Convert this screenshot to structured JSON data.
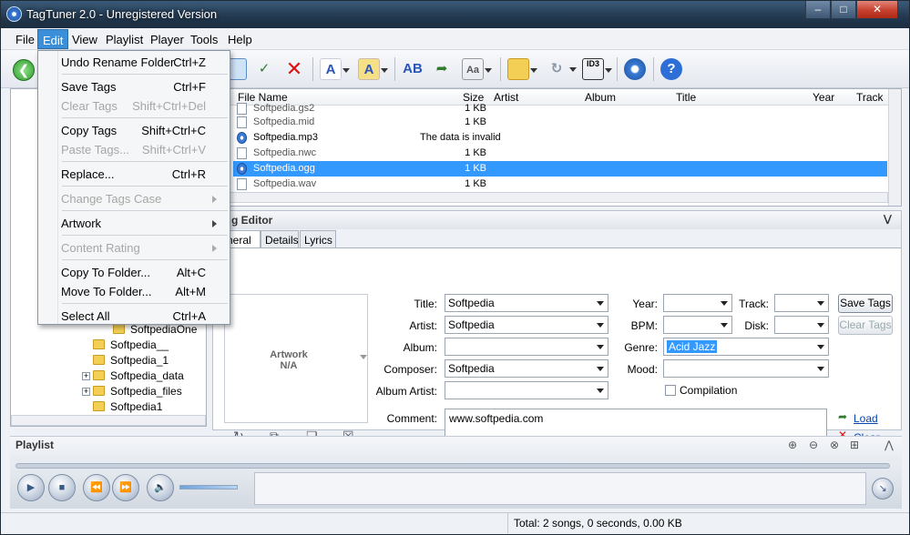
{
  "window": {
    "title": "TagTuner 2.0 - Unregistered Version",
    "min": "–",
    "max": "□",
    "close": "✕"
  },
  "menubar": [
    "File",
    "Edit",
    "View",
    "Playlist",
    "Player",
    "Tools",
    "Help"
  ],
  "edit_menu": {
    "undo": {
      "label": "Undo Rename Folder",
      "key": "Ctrl+Z"
    },
    "save_tags": {
      "label": "Save Tags",
      "key": "Ctrl+F"
    },
    "clear_tags": {
      "label": "Clear Tags",
      "key": "Shift+Ctrl+Del"
    },
    "copy_tags": {
      "label": "Copy Tags",
      "key": "Shift+Ctrl+C"
    },
    "paste_tags": {
      "label": "Paste Tags...",
      "key": "Shift+Ctrl+V"
    },
    "replace": {
      "label": "Replace...",
      "key": "Ctrl+R"
    },
    "change_case": {
      "label": "Change Tags Case"
    },
    "artwork": {
      "label": "Artwork"
    },
    "content_rating": {
      "label": "Content Rating"
    },
    "copy_folder": {
      "label": "Copy To Folder...",
      "key": "Alt+C"
    },
    "move_folder": {
      "label": "Move To Folder...",
      "key": "Alt+M"
    },
    "select_all": {
      "label": "Select All",
      "key": "Ctrl+A"
    }
  },
  "tree": [
    "SoftpediaOne",
    "Softpedia__",
    "Softpedia_1",
    "Softpedia_data",
    "Softpedia_files",
    "Softpedia1"
  ],
  "file_list": {
    "columns": [
      "File Name",
      "Size",
      "Artist",
      "Album",
      "Title",
      "Year",
      "Track"
    ],
    "rows": [
      {
        "name": "Softpedia.gs2",
        "size": "1 KB"
      },
      {
        "name": "Softpedia.mid",
        "size": "1 KB"
      },
      {
        "name": "Softpedia.mp3",
        "size": "",
        "message": "The data is invalid"
      },
      {
        "name": "Softpedia.nwc",
        "size": "1 KB"
      },
      {
        "name": "Softpedia.ogg",
        "size": "1 KB"
      },
      {
        "name": "Softpedia.wav",
        "size": "1 KB"
      }
    ]
  },
  "tag_editor": {
    "header": "g Editor",
    "tabs": [
      "neral",
      "Details",
      "Lyrics"
    ],
    "artwork": {
      "line1": "Artwork",
      "line2": "N/A"
    },
    "labels": {
      "title": "Title:",
      "artist": "Artist:",
      "album": "Album:",
      "genre": "Genre:",
      "composer": "Composer:",
      "album_artist": "Album Artist:",
      "year": "Year:",
      "track": "Track:",
      "bpm": "BPM:",
      "disk": "Disk:",
      "mood": "Mood:",
      "comment": "Comment:",
      "compilation": "Compilation"
    },
    "values": {
      "title": "Softpedia",
      "artist": "Softpedia",
      "album": "",
      "genre": "Acid Jazz",
      "composer": "Softpedia",
      "album_artist": "",
      "year": "",
      "track": "",
      "bpm": "",
      "disk": "",
      "mood": "",
      "comment": "www.softpedia.com"
    },
    "buttons": {
      "save": "Save Tags",
      "clear": "Clear Tags",
      "load_link": "Load",
      "clear_link": "Clear"
    }
  },
  "playlist": {
    "label": "Playlist"
  },
  "status": {
    "text": "Total: 2 songs, 0 seconds, 0.00 KB"
  }
}
